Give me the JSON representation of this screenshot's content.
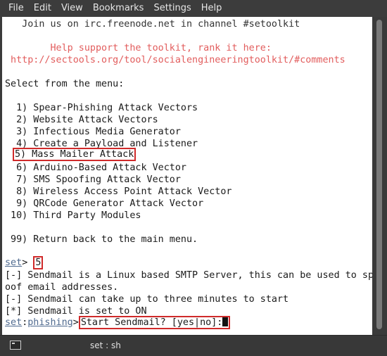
{
  "menubar": [
    "File",
    "Edit",
    "View",
    "Bookmarks",
    "Settings",
    "Help"
  ],
  "terminal": {
    "irc_line": "   Join us on irc.freenode.net in channel #setoolkit",
    "support_line": "        Help support the toolkit, rank it here:",
    "support_url": " http://sectools.org/tool/socialengineeringtoolkit/#comments",
    "select_prompt": "Select from the menu:",
    "menu_options": [
      "  1) Spear-Phishing Attack Vectors",
      "  2) Website Attack Vectors",
      "  3) Infectious Media Generator",
      "  4) Create a Payload and Listener",
      "5) Mass Mailer Attack",
      "  6) Arduino-Based Attack Vector",
      "  7) SMS Spoofing Attack Vector",
      "  8) Wireless Access Point Attack Vector",
      "  9) QRCode Generator Attack Vector",
      " 10) Third Party Modules"
    ],
    "return_option": " 99) Return back to the main menu.",
    "prompt_set": "set",
    "prompt_gt": ">",
    "input_value": "5",
    "output_1a": "[-] Sendmail is a Linux based SMTP Server, this can be used to sp",
    "output_1b": "oof email addresses.",
    "output_2": "[-] Sendmail can take up to three minutes to start",
    "output_3": "[*] Sendmail is set to ON",
    "prompt_phishing": "phishing",
    "prompt_colon": ":",
    "question": "Start Sendmail? [yes|no]:"
  },
  "statusbar": {
    "tab_label": "set : sh"
  }
}
